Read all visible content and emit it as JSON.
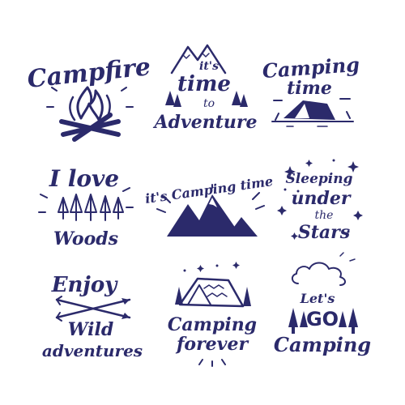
{
  "ink_color": "#2b2a6b",
  "background_color": "#ffffff",
  "badges": [
    {
      "lines": [
        "Campfire"
      ],
      "icon": "campfire-icon"
    },
    {
      "lines": [
        "it's",
        "time",
        "to",
        "Adventure"
      ],
      "icon": "mountain-forest-icon"
    },
    {
      "lines": [
        "Camping",
        "time"
      ],
      "icon": "tent-icon"
    },
    {
      "lines": [
        "I love",
        "Woods"
      ],
      "icon": "pine-trees-icon"
    },
    {
      "lines": [
        "it's Camping time"
      ],
      "icon": "mountains-icon"
    },
    {
      "lines": [
        "Sleeping",
        "under",
        "the",
        "Stars"
      ],
      "icon": "stars-icon"
    },
    {
      "lines": [
        "Enjoy",
        "Wild",
        "adventures"
      ],
      "icon": "crossed-arrows-icon"
    },
    {
      "lines": [
        "Camping",
        "forever"
      ],
      "icon": "tent-stars-icon"
    },
    {
      "lines": [
        "Let's",
        "GO",
        "Camping"
      ],
      "icon": "cloud-trees-icon"
    }
  ]
}
